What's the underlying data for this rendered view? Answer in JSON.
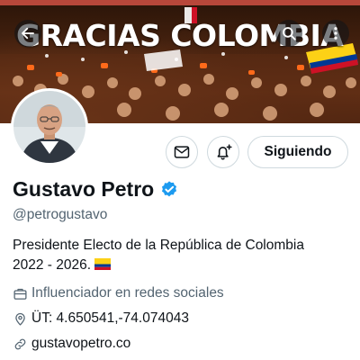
{
  "header": {
    "banner_text": "GRACIAS COLOMBIA",
    "back_icon": "arrow-left-icon",
    "search_icon": "search-icon",
    "more_icon": "more-vertical-icon"
  },
  "actions": {
    "message_icon": "mail-icon",
    "notifications_icon": "bell-plus-icon",
    "follow_label": "Siguiendo"
  },
  "profile": {
    "name": "Gustavo Petro",
    "handle": "@petrogustavo",
    "bio_line1": "Presidente Electo de la República de Colombia",
    "bio_line2": "2022 - 2026.",
    "category": "Influenciador en redes sociales",
    "location": "ÜT: 4.650541,-74.074043",
    "website": "gustavopetro.co"
  },
  "colors": {
    "verified": "#1d9bf0",
    "text": "#0f1419",
    "secondary": "#536471",
    "border": "#cfd9de"
  }
}
